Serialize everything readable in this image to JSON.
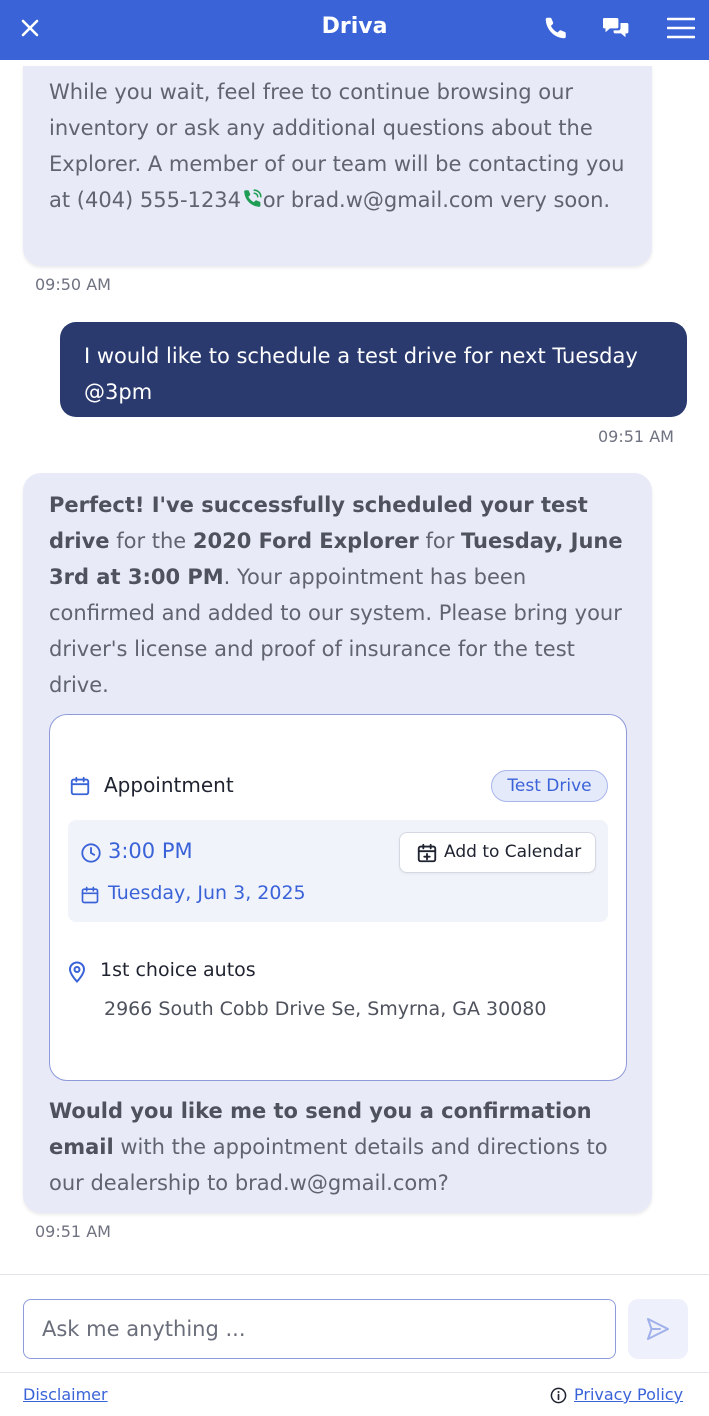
{
  "header": {
    "title": "Driva",
    "close_icon": "close-icon",
    "phone_icon": "phone-icon",
    "chat_icon": "chat-icon",
    "menu_icon": "menu-icon"
  },
  "messages": [
    {
      "role": "bot",
      "text_part1": "While you wait, feel free to continue browsing our inventory or ask any additional questions about the Explorer. A member of our team will be contacting you at (404) 555-1234 ",
      "text_part2": "or brad.w@gmail.com very soon.",
      "time": "09:50 AM"
    },
    {
      "role": "user",
      "text": "I would like to schedule a test drive for next Tuesday @3pm",
      "time": "09:51 AM"
    },
    {
      "role": "bot",
      "intro_bold1": "Perfect! I've successfully scheduled your test drive",
      "intro_text1": " for the ",
      "intro_bold2": "2020 Ford Explorer",
      "intro_text2": " for ",
      "intro_bold3": "Tuesday, June 3rd at 3:00 PM",
      "intro_text3": ". Your appointment has been confirmed and added to our system. Please bring your driver's license and proof of insurance for the test drive.",
      "outro_bold": "Would you like me to send you a confirmation email",
      "outro_text": " with the appointment details and directions to our dealership to brad.w@gmail.com?",
      "time": "09:51 AM"
    }
  ],
  "appointment": {
    "label": "Appointment",
    "badge": "Test Drive",
    "time": "3:00 PM",
    "date": "Tuesday, Jun 3, 2025",
    "add_calendar_label": "Add to Calendar",
    "location_name": "1st choice autos",
    "location_address": "2966 South Cobb Drive Se, Smyrna, GA 30080"
  },
  "composer": {
    "placeholder": "Ask me anything ..."
  },
  "footer": {
    "disclaimer": "Disclaimer",
    "privacy": "Privacy Policy"
  },
  "colors": {
    "brand": "#3a63d8",
    "user_bubble": "#2a3a6e",
    "bot_bubble": "#e8eaf8",
    "phone_green": "#1f9d55"
  }
}
